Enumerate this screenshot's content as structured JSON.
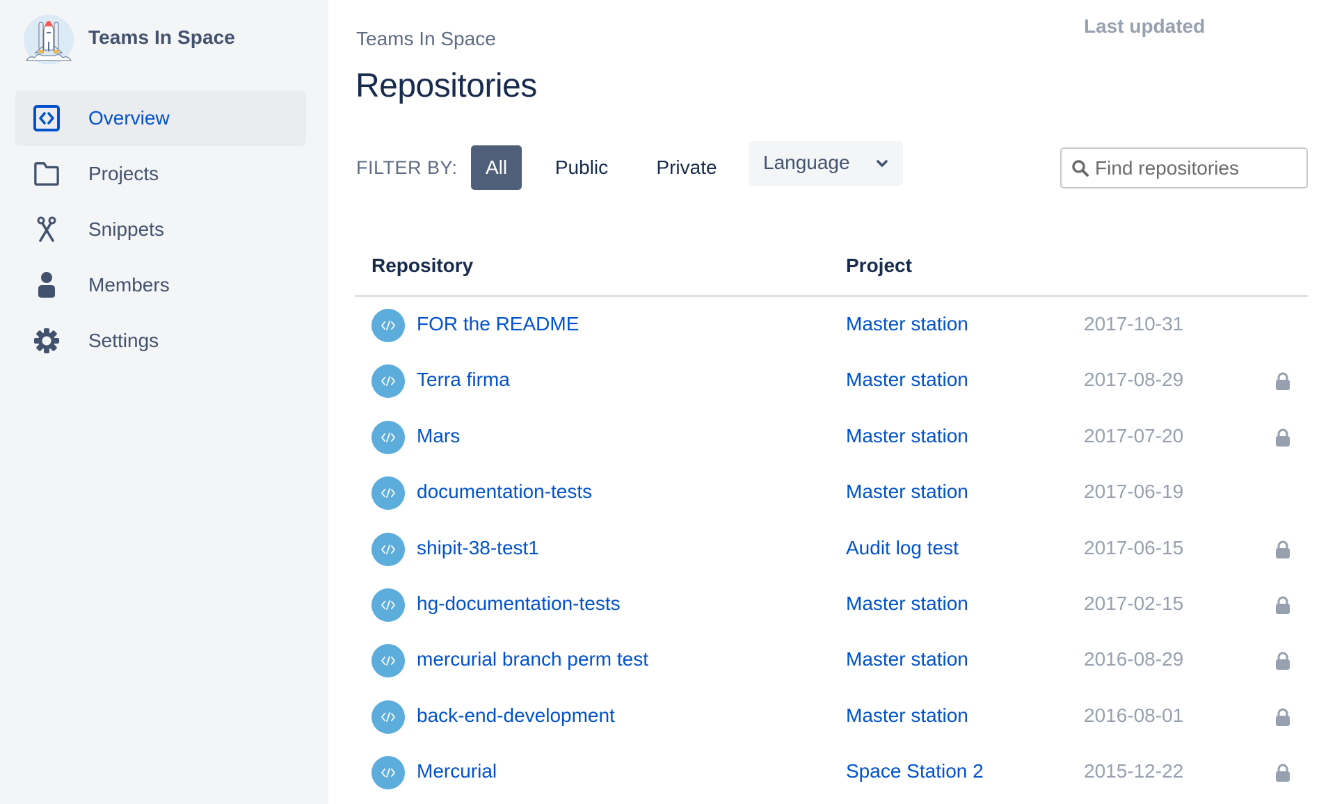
{
  "sidebar": {
    "team_name": "Teams In Space",
    "logo_icon": "rocket-logo",
    "items": [
      {
        "label": "Overview",
        "icon": "code-box-icon",
        "active": true
      },
      {
        "label": "Projects",
        "icon": "folder-icon",
        "active": false
      },
      {
        "label": "Snippets",
        "icon": "scissors-icon",
        "active": false
      },
      {
        "label": "Members",
        "icon": "person-icon",
        "active": false
      },
      {
        "label": "Settings",
        "icon": "gear-icon",
        "active": false
      }
    ]
  },
  "header": {
    "breadcrumb": "Teams In Space",
    "title": "Repositories"
  },
  "filters": {
    "label": "FILTER BY:",
    "options": [
      "All",
      "Public",
      "Private"
    ],
    "selected": "All",
    "language_label": "Language",
    "search_placeholder": "Find repositories",
    "search_value": ""
  },
  "table": {
    "columns": [
      "Repository",
      "Project",
      "Last updated"
    ],
    "rows": [
      {
        "name": "FOR the README",
        "project": "Master station",
        "updated": "2017-10-31",
        "private": false
      },
      {
        "name": "Terra firma",
        "project": "Master station",
        "updated": "2017-08-29",
        "private": true
      },
      {
        "name": "Mars",
        "project": "Master station",
        "updated": "2017-07-20",
        "private": true
      },
      {
        "name": "documentation-tests",
        "project": "Master station",
        "updated": "2017-06-19",
        "private": false
      },
      {
        "name": "shipit-38-test1",
        "project": "Audit log test",
        "updated": "2017-06-15",
        "private": true
      },
      {
        "name": "hg-documentation-tests",
        "project": "Master station",
        "updated": "2017-02-15",
        "private": true
      },
      {
        "name": "mercurial branch perm test",
        "project": "Master station",
        "updated": "2016-08-29",
        "private": true
      },
      {
        "name": "back-end-development",
        "project": "Master station",
        "updated": "2016-08-01",
        "private": true
      },
      {
        "name": "Mercurial",
        "project": "Space Station 2",
        "updated": "2015-12-22",
        "private": true
      }
    ]
  },
  "colors": {
    "sidebar_bg": "#F4F5F7",
    "active_nav_bg": "#EBECF0",
    "link": "#0052CC",
    "filter_active_bg": "#505F79",
    "repo_icon_bg": "#5DADDC",
    "muted_text": "#97A0AF"
  }
}
